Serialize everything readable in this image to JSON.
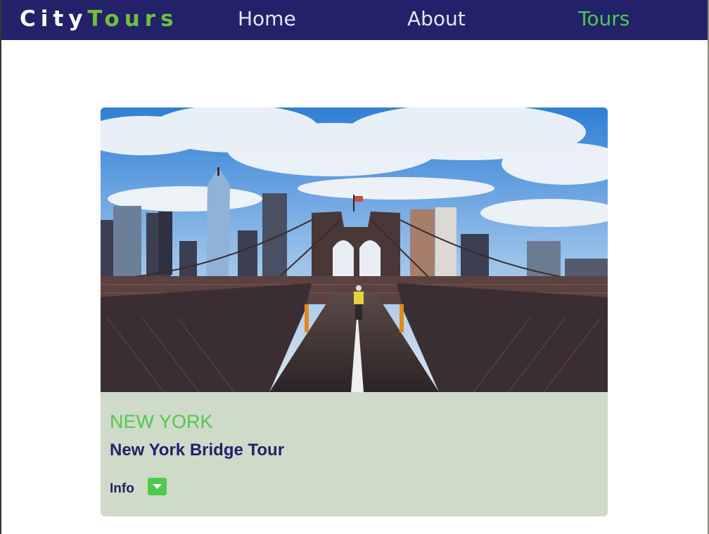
{
  "navbar": {
    "brand_part1": "City",
    "brand_part2": "Tours",
    "links": [
      {
        "label": "Home",
        "active": false
      },
      {
        "label": "About",
        "active": false
      },
      {
        "label": "Tours",
        "active": true
      }
    ]
  },
  "tour": {
    "city": "NEW YORK",
    "name": "New York Bridge Tour",
    "info_label": "Info",
    "info_icon": "caret-down-icon",
    "photo_subject": "brooklyn-bridge-photo"
  },
  "colors": {
    "nav_bg": "#232169",
    "brand_accent": "#6dc13a",
    "active_link": "#4ec94e",
    "card_bg": "#cfdac9",
    "title_text": "#232169"
  }
}
